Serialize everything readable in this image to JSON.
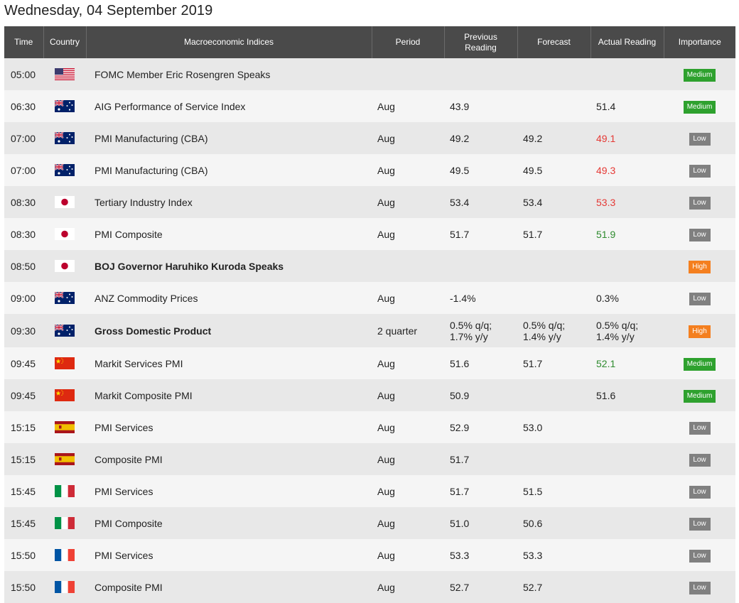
{
  "page": {
    "title": "Wednesday, 04 September 2019"
  },
  "table": {
    "headers": {
      "time": "Time",
      "country": "Country",
      "index": "Macroeconomic Indices",
      "period": "Period",
      "prev_line1": "Previous",
      "prev_line2": "Reading",
      "forecast": "Forecast",
      "actual": "Actual Reading",
      "importance": "Importance"
    },
    "rows": [
      {
        "time": "05:00",
        "flag": "us-flag-icon",
        "index": "FOMC Member Eric Rosengren Speaks",
        "bold": false,
        "period": "",
        "prev": "",
        "prev2": "",
        "forecast": "",
        "forecast2": "",
        "actual": "",
        "actual2": "",
        "actual_color": "",
        "importance": "Medium"
      },
      {
        "time": "06:30",
        "flag": "au-flag-icon",
        "index": "AIG Performance of Service Index",
        "bold": false,
        "period": "Aug",
        "prev": "43.9",
        "prev2": "",
        "forecast": "",
        "forecast2": "",
        "actual": "51.4",
        "actual2": "",
        "actual_color": "",
        "importance": "Medium"
      },
      {
        "time": "07:00",
        "flag": "au-flag-icon",
        "index": "PMI Manufacturing (CBA)",
        "bold": false,
        "period": "Aug",
        "prev": "49.2",
        "prev2": "",
        "forecast": "49.2",
        "forecast2": "",
        "actual": "49.1",
        "actual2": "",
        "actual_color": "red",
        "importance": "Low"
      },
      {
        "time": "07:00",
        "flag": "au-flag-icon",
        "index": "PMI Manufacturing (CBA)",
        "bold": false,
        "period": "Aug",
        "prev": "49.5",
        "prev2": "",
        "forecast": "49.5",
        "forecast2": "",
        "actual": "49.3",
        "actual2": "",
        "actual_color": "red",
        "importance": "Low"
      },
      {
        "time": "08:30",
        "flag": "jp-flag-icon",
        "index": "Tertiary Industry Index",
        "bold": false,
        "period": "Aug",
        "prev": "53.4",
        "prev2": "",
        "forecast": "53.4",
        "forecast2": "",
        "actual": "53.3",
        "actual2": "",
        "actual_color": "red",
        "importance": "Low"
      },
      {
        "time": "08:30",
        "flag": "jp-flag-icon",
        "index": "PMI Composite",
        "bold": false,
        "period": "Aug",
        "prev": "51.7",
        "prev2": "",
        "forecast": "51.7",
        "forecast2": "",
        "actual": "51.9",
        "actual2": "",
        "actual_color": "green",
        "importance": "Low"
      },
      {
        "time": "08:50",
        "flag": "jp-flag-icon",
        "index": "BOJ Governor Haruhiko Kuroda Speaks",
        "bold": true,
        "period": "",
        "prev": "",
        "prev2": "",
        "forecast": "",
        "forecast2": "",
        "actual": "",
        "actual2": "",
        "actual_color": "",
        "importance": "High"
      },
      {
        "time": "09:00",
        "flag": "au-flag-icon",
        "index": "ANZ Commodity Prices",
        "bold": false,
        "period": "Aug",
        "prev": "-1.4%",
        "prev2": "",
        "forecast": "",
        "forecast2": "",
        "actual": "0.3%",
        "actual2": "",
        "actual_color": "",
        "importance": "Low"
      },
      {
        "time": "09:30",
        "flag": "au-flag-icon",
        "index": "Gross Domestic Product",
        "bold": true,
        "period": "2 quarter",
        "prev": "0.5% q/q;",
        "prev2": "1.7% y/y",
        "forecast": "0.5% q/q;",
        "forecast2": "1.4% y/y",
        "actual": "0.5% q/q;",
        "actual2": "1.4% y/y",
        "actual_color": "",
        "importance": "High"
      },
      {
        "time": "09:45",
        "flag": "cn-flag-icon",
        "index": "Markit Services PMI",
        "bold": false,
        "period": "Aug",
        "prev": "51.6",
        "prev2": "",
        "forecast": "51.7",
        "forecast2": "",
        "actual": "52.1",
        "actual2": "",
        "actual_color": "green",
        "importance": "Medium"
      },
      {
        "time": "09:45",
        "flag": "cn-flag-icon",
        "index": "Markit Composite PMI",
        "bold": false,
        "period": "Aug",
        "prev": "50.9",
        "prev2": "",
        "forecast": "",
        "forecast2": "",
        "actual": "51.6",
        "actual2": "",
        "actual_color": "",
        "importance": "Medium"
      },
      {
        "time": "15:15",
        "flag": "es-flag-icon",
        "index": "PMI Services",
        "bold": false,
        "period": "Aug",
        "prev": "52.9",
        "prev2": "",
        "forecast": "53.0",
        "forecast2": "",
        "actual": "",
        "actual2": "",
        "actual_color": "",
        "importance": "Low"
      },
      {
        "time": "15:15",
        "flag": "es-flag-icon",
        "index": "Composite PMI",
        "bold": false,
        "period": "Aug",
        "prev": "51.7",
        "prev2": "",
        "forecast": "",
        "forecast2": "",
        "actual": "",
        "actual2": "",
        "actual_color": "",
        "importance": "Low"
      },
      {
        "time": "15:45",
        "flag": "it-flag-icon",
        "index": "PMI Services",
        "bold": false,
        "period": "Aug",
        "prev": "51.7",
        "prev2": "",
        "forecast": "51.5",
        "forecast2": "",
        "actual": "",
        "actual2": "",
        "actual_color": "",
        "importance": "Low"
      },
      {
        "time": "15:45",
        "flag": "it-flag-icon",
        "index": "PMI Composite",
        "bold": false,
        "period": "Aug",
        "prev": "51.0",
        "prev2": "",
        "forecast": "50.6",
        "forecast2": "",
        "actual": "",
        "actual2": "",
        "actual_color": "",
        "importance": "Low"
      },
      {
        "time": "15:50",
        "flag": "fr-flag-icon",
        "index": "PMI Services",
        "bold": false,
        "period": "Aug",
        "prev": "53.3",
        "prev2": "",
        "forecast": "53.3",
        "forecast2": "",
        "actual": "",
        "actual2": "",
        "actual_color": "",
        "importance": "Low"
      },
      {
        "time": "15:50",
        "flag": "fr-flag-icon",
        "index": "Composite PMI",
        "bold": false,
        "period": "Aug",
        "prev": "52.7",
        "prev2": "",
        "forecast": "52.7",
        "forecast2": "",
        "actual": "",
        "actual2": "",
        "actual_color": "",
        "importance": "Low"
      }
    ]
  },
  "colors": {
    "header_bg": "#4a4a4a",
    "row_odd": "#e8e8e8",
    "row_even": "#f5f5f5",
    "importance_medium": "#2ea12e",
    "importance_high": "#f47f1f",
    "importance_low": "#808080",
    "actual_below": "#e53935",
    "actual_above": "#2e8b2e"
  }
}
